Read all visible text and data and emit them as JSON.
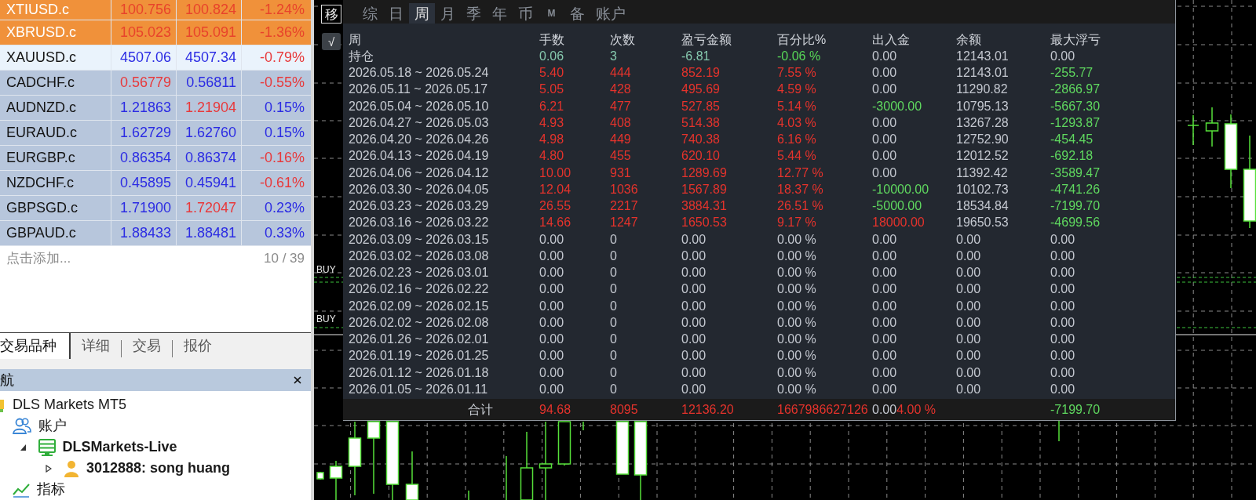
{
  "market_watch": {
    "rows": [
      {
        "color": "#f0913a",
        "symbol": {
          "text": "XTIUSD.c",
          "color": "#ffffff"
        },
        "bid": {
          "text": "100.756",
          "color": "#e8432b"
        },
        "ask": {
          "text": "100.824",
          "color": "#e8432b"
        },
        "change": {
          "text": "-1.24%",
          "color": "#e8432b"
        }
      },
      {
        "color": "#f0913a",
        "symbol": {
          "text": "XBRUSD.c",
          "color": "#ffffff"
        },
        "bid": {
          "text": "105.023",
          "color": "#e8432b"
        },
        "ask": {
          "text": "105.091",
          "color": "#e8432b"
        },
        "change": {
          "text": "-1.36%",
          "color": "#e8432b"
        }
      },
      {
        "color": "#eaf3fc",
        "symbol": {
          "text": "XAUUSD.c",
          "color": "#141414"
        },
        "bid": {
          "text": "4507.06",
          "color": "#2b2be3"
        },
        "ask": {
          "text": "4507.34",
          "color": "#2b2be3"
        },
        "change": {
          "text": "-0.79%",
          "color": "#e8383a"
        }
      },
      {
        "color": "#b7c6dc",
        "symbol": {
          "text": "CADCHF.c",
          "color": "#141414"
        },
        "bid": {
          "text": "0.56779",
          "color": "#e8383a"
        },
        "ask": {
          "text": "0.56811",
          "color": "#2b2be3"
        },
        "change": {
          "text": "-0.55%",
          "color": "#e8383a"
        }
      },
      {
        "color": "#b7c6dc",
        "symbol": {
          "text": "AUDNZD.c",
          "color": "#141414"
        },
        "bid": {
          "text": "1.21863",
          "color": "#2b2be3"
        },
        "ask": {
          "text": "1.21904",
          "color": "#e8383a"
        },
        "change": {
          "text": "0.15%",
          "color": "#2b2be3"
        }
      },
      {
        "color": "#b7c6dc",
        "symbol": {
          "text": "EURAUD.c",
          "color": "#141414"
        },
        "bid": {
          "text": "1.62729",
          "color": "#2b2be3"
        },
        "ask": {
          "text": "1.62760",
          "color": "#2b2be3"
        },
        "change": {
          "text": "0.15%",
          "color": "#2b2be3"
        }
      },
      {
        "color": "#b7c6dc",
        "symbol": {
          "text": "EURGBP.c",
          "color": "#141414"
        },
        "bid": {
          "text": "0.86354",
          "color": "#2b2be3"
        },
        "ask": {
          "text": "0.86374",
          "color": "#2b2be3"
        },
        "change": {
          "text": "-0.16%",
          "color": "#e8383a"
        }
      },
      {
        "color": "#b7c6dc",
        "symbol": {
          "text": "NZDCHF.c",
          "color": "#141414"
        },
        "bid": {
          "text": "0.45895",
          "color": "#2b2be3"
        },
        "ask": {
          "text": "0.45941",
          "color": "#2b2be3"
        },
        "change": {
          "text": "-0.61%",
          "color": "#e8383a"
        }
      },
      {
        "color": "#b7c6dc",
        "symbol": {
          "text": "GBPSGD.c",
          "color": "#141414"
        },
        "bid": {
          "text": "1.71900",
          "color": "#2b2be3"
        },
        "ask": {
          "text": "1.72047",
          "color": "#e8383a"
        },
        "change": {
          "text": "0.23%",
          "color": "#2b2be3"
        }
      },
      {
        "color": "#b7c6dc",
        "symbol": {
          "text": "GBPAUD.c",
          "color": "#141414"
        },
        "bid": {
          "text": "1.88433",
          "color": "#2b2be3"
        },
        "ask": {
          "text": "1.88481",
          "color": "#2b2be3"
        },
        "change": {
          "text": "0.33%",
          "color": "#2b2be3"
        }
      }
    ],
    "add_prompt": "点击添加...",
    "count": "10 / 39"
  },
  "panel_tabs": [
    {
      "label": "交易品种",
      "selected": true
    },
    {
      "label": "详细",
      "selected": false
    },
    {
      "label": "交易",
      "selected": false
    },
    {
      "label": "报价",
      "selected": false
    }
  ],
  "navigator": {
    "title": "航",
    "tree": [
      {
        "label": "DLS Markets MT5",
        "kind": "broker",
        "children": [
          {
            "label": "账户",
            "kind": "accounts",
            "children": [
              {
                "label": "DLSMarkets-Live",
                "kind": "server",
                "bold": true,
                "expanded": true,
                "children": [
                  {
                    "label": "3012888: song huang",
                    "kind": "account",
                    "bold": true,
                    "expanded": false
                  }
                ]
              }
            ]
          },
          {
            "label": "指标",
            "kind": "indicators"
          }
        ]
      }
    ]
  },
  "chart": {
    "tools": [
      {
        "label": "移",
        "kind": "outlined"
      },
      {
        "label": "√",
        "kind": "filled"
      }
    ],
    "order_labels": [
      "BUY",
      "BUY"
    ]
  },
  "report": {
    "tabs": [
      {
        "label": "综",
        "kind": "glyph",
        "selected": false
      },
      {
        "label": "日",
        "kind": "glyph",
        "selected": false
      },
      {
        "label": "周",
        "kind": "glyph",
        "selected": true
      },
      {
        "label": "月",
        "kind": "glyph",
        "selected": false
      },
      {
        "label": "季",
        "kind": "glyph",
        "selected": false
      },
      {
        "label": "年",
        "kind": "glyph",
        "selected": false
      },
      {
        "label": "币",
        "kind": "glyph",
        "selected": false
      },
      {
        "label": "M",
        "kind": "letter",
        "selected": false
      },
      {
        "label": "备",
        "kind": "glyph",
        "selected": false
      },
      {
        "label": "账户",
        "kind": "glyph",
        "selected": false
      }
    ],
    "columns": [
      "周",
      "手数",
      "次数",
      "盈亏金额",
      "百分比%",
      "出入金",
      "余额",
      "最大浮亏"
    ],
    "rows": [
      {
        "cells": [
          {
            "text": "持仓"
          },
          {
            "text": "0.06",
            "color": "#86c9ae"
          },
          {
            "text": "3",
            "color": "#86c9ae"
          },
          {
            "text": "-6.81",
            "color": "#86c9ae"
          },
          {
            "text": "-0.06 %",
            "color": "#58d858"
          },
          {
            "text": "0.00",
            "color": "#c4c8d0"
          },
          {
            "text": "12143.01",
            "color": "#c4c8d0"
          },
          {
            "text": "0.00",
            "color": "#c4c8d0"
          }
        ]
      },
      {
        "cells": [
          {
            "text": "2026.05.18 ~ 2026.05.24"
          },
          {
            "text": "5.40",
            "color": "#e5332c"
          },
          {
            "text": "444",
            "color": "#e5332c"
          },
          {
            "text": "852.19",
            "color": "#e5332c"
          },
          {
            "text": "7.55 %",
            "color": "#e5332c"
          },
          {
            "text": "0.00",
            "color": "#c4c8d0"
          },
          {
            "text": "12143.01",
            "color": "#c4c8d0"
          },
          {
            "text": "-255.77",
            "color": "#5fd85f"
          }
        ]
      },
      {
        "cells": [
          {
            "text": "2026.05.11 ~ 2026.05.17"
          },
          {
            "text": "5.05",
            "color": "#e5332c"
          },
          {
            "text": "428",
            "color": "#e5332c"
          },
          {
            "text": "495.69",
            "color": "#e5332c"
          },
          {
            "text": "4.59 %",
            "color": "#e5332c"
          },
          {
            "text": "0.00",
            "color": "#c4c8d0"
          },
          {
            "text": "11290.82",
            "color": "#c4c8d0"
          },
          {
            "text": "-2866.97",
            "color": "#5fd85f"
          }
        ]
      },
      {
        "cells": [
          {
            "text": "2026.05.04 ~ 2026.05.10"
          },
          {
            "text": "6.21",
            "color": "#e5332c"
          },
          {
            "text": "477",
            "color": "#e5332c"
          },
          {
            "text": "527.85",
            "color": "#e5332c"
          },
          {
            "text": "5.14 %",
            "color": "#e5332c"
          },
          {
            "text": "-3000.00",
            "color": "#5fd85f"
          },
          {
            "text": "10795.13",
            "color": "#c4c8d0"
          },
          {
            "text": "-5667.30",
            "color": "#5fd85f"
          }
        ]
      },
      {
        "cells": [
          {
            "text": "2026.04.27 ~ 2026.05.03"
          },
          {
            "text": "4.93",
            "color": "#e5332c"
          },
          {
            "text": "408",
            "color": "#e5332c"
          },
          {
            "text": "514.38",
            "color": "#e5332c"
          },
          {
            "text": "4.03 %",
            "color": "#e5332c"
          },
          {
            "text": "0.00",
            "color": "#c4c8d0"
          },
          {
            "text": "13267.28",
            "color": "#c4c8d0"
          },
          {
            "text": "-1293.87",
            "color": "#5fd85f"
          }
        ]
      },
      {
        "cells": [
          {
            "text": "2026.04.20 ~ 2026.04.26"
          },
          {
            "text": "4.98",
            "color": "#e5332c"
          },
          {
            "text": "449",
            "color": "#e5332c"
          },
          {
            "text": "740.38",
            "color": "#e5332c"
          },
          {
            "text": "6.16 %",
            "color": "#e5332c"
          },
          {
            "text": "0.00",
            "color": "#c4c8d0"
          },
          {
            "text": "12752.90",
            "color": "#c4c8d0"
          },
          {
            "text": "-454.45",
            "color": "#5fd85f"
          }
        ]
      },
      {
        "cells": [
          {
            "text": "2026.04.13 ~ 2026.04.19"
          },
          {
            "text": "4.80",
            "color": "#e5332c"
          },
          {
            "text": "455",
            "color": "#e5332c"
          },
          {
            "text": "620.10",
            "color": "#e5332c"
          },
          {
            "text": "5.44 %",
            "color": "#e5332c"
          },
          {
            "text": "0.00",
            "color": "#c4c8d0"
          },
          {
            "text": "12012.52",
            "color": "#c4c8d0"
          },
          {
            "text": "-692.18",
            "color": "#5fd85f"
          }
        ]
      },
      {
        "cells": [
          {
            "text": "2026.04.06 ~ 2026.04.12"
          },
          {
            "text": "10.00",
            "color": "#e5332c"
          },
          {
            "text": "931",
            "color": "#e5332c"
          },
          {
            "text": "1289.69",
            "color": "#e5332c"
          },
          {
            "text": "12.77 %",
            "color": "#e5332c"
          },
          {
            "text": "0.00",
            "color": "#c4c8d0"
          },
          {
            "text": "11392.42",
            "color": "#c4c8d0"
          },
          {
            "text": "-3589.47",
            "color": "#5fd85f"
          }
        ]
      },
      {
        "cells": [
          {
            "text": "2026.03.30 ~ 2026.04.05"
          },
          {
            "text": "12.04",
            "color": "#e5332c"
          },
          {
            "text": "1036",
            "color": "#e5332c"
          },
          {
            "text": "1567.89",
            "color": "#e5332c"
          },
          {
            "text": "18.37 %",
            "color": "#e5332c"
          },
          {
            "text": "-10000.00",
            "color": "#5fd85f"
          },
          {
            "text": "10102.73",
            "color": "#c4c8d0"
          },
          {
            "text": "-4741.26",
            "color": "#5fd85f"
          }
        ]
      },
      {
        "cells": [
          {
            "text": "2026.03.23 ~ 2026.03.29"
          },
          {
            "text": "26.55",
            "color": "#e5332c"
          },
          {
            "text": "2217",
            "color": "#e5332c"
          },
          {
            "text": "3884.31",
            "color": "#e5332c"
          },
          {
            "text": "26.51 %",
            "color": "#e5332c"
          },
          {
            "text": "-5000.00",
            "color": "#5fd85f"
          },
          {
            "text": "18534.84",
            "color": "#c4c8d0"
          },
          {
            "text": "-7199.70",
            "color": "#5fd85f"
          }
        ]
      },
      {
        "cells": [
          {
            "text": "2026.03.16 ~ 2026.03.22"
          },
          {
            "text": "14.66",
            "color": "#e5332c"
          },
          {
            "text": "1247",
            "color": "#e5332c"
          },
          {
            "text": "1650.53",
            "color": "#e5332c"
          },
          {
            "text": "9.17 %",
            "color": "#e5332c"
          },
          {
            "text": "18000.00",
            "color": "#e5332c"
          },
          {
            "text": "19650.53",
            "color": "#c4c8d0"
          },
          {
            "text": "-4699.56",
            "color": "#5fd85f"
          }
        ]
      },
      {
        "cells": [
          {
            "text": "2026.03.09 ~ 2026.03.15"
          },
          {
            "text": "0.00",
            "color": "#c4c8d0"
          },
          {
            "text": "0",
            "color": "#c4c8d0"
          },
          {
            "text": "0.00",
            "color": "#c4c8d0"
          },
          {
            "text": "0.00 %",
            "color": "#c4c8d0"
          },
          {
            "text": "0.00",
            "color": "#c4c8d0"
          },
          {
            "text": "0.00",
            "color": "#c4c8d0"
          },
          {
            "text": "0.00",
            "color": "#c4c8d0"
          }
        ]
      },
      {
        "cells": [
          {
            "text": "2026.03.02 ~ 2026.03.08"
          },
          {
            "text": "0.00",
            "color": "#c4c8d0"
          },
          {
            "text": "0",
            "color": "#c4c8d0"
          },
          {
            "text": "0.00",
            "color": "#c4c8d0"
          },
          {
            "text": "0.00 %",
            "color": "#c4c8d0"
          },
          {
            "text": "0.00",
            "color": "#c4c8d0"
          },
          {
            "text": "0.00",
            "color": "#c4c8d0"
          },
          {
            "text": "0.00",
            "color": "#c4c8d0"
          }
        ]
      },
      {
        "cells": [
          {
            "text": "2026.02.23 ~ 2026.03.01"
          },
          {
            "text": "0.00",
            "color": "#c4c8d0"
          },
          {
            "text": "0",
            "color": "#c4c8d0"
          },
          {
            "text": "0.00",
            "color": "#c4c8d0"
          },
          {
            "text": "0.00 %",
            "color": "#c4c8d0"
          },
          {
            "text": "0.00",
            "color": "#c4c8d0"
          },
          {
            "text": "0.00",
            "color": "#c4c8d0"
          },
          {
            "text": "0.00",
            "color": "#c4c8d0"
          }
        ]
      },
      {
        "cells": [
          {
            "text": "2026.02.16 ~ 2026.02.22"
          },
          {
            "text": "0.00",
            "color": "#c4c8d0"
          },
          {
            "text": "0",
            "color": "#c4c8d0"
          },
          {
            "text": "0.00",
            "color": "#c4c8d0"
          },
          {
            "text": "0.00 %",
            "color": "#c4c8d0"
          },
          {
            "text": "0.00",
            "color": "#c4c8d0"
          },
          {
            "text": "0.00",
            "color": "#c4c8d0"
          },
          {
            "text": "0.00",
            "color": "#c4c8d0"
          }
        ]
      },
      {
        "cells": [
          {
            "text": "2026.02.09 ~ 2026.02.15"
          },
          {
            "text": "0.00",
            "color": "#c4c8d0"
          },
          {
            "text": "0",
            "color": "#c4c8d0"
          },
          {
            "text": "0.00",
            "color": "#c4c8d0"
          },
          {
            "text": "0.00 %",
            "color": "#c4c8d0"
          },
          {
            "text": "0.00",
            "color": "#c4c8d0"
          },
          {
            "text": "0.00",
            "color": "#c4c8d0"
          },
          {
            "text": "0.00",
            "color": "#c4c8d0"
          }
        ]
      },
      {
        "cells": [
          {
            "text": "2026.02.02 ~ 2026.02.08"
          },
          {
            "text": "0.00",
            "color": "#c4c8d0"
          },
          {
            "text": "0",
            "color": "#c4c8d0"
          },
          {
            "text": "0.00",
            "color": "#c4c8d0"
          },
          {
            "text": "0.00 %",
            "color": "#c4c8d0"
          },
          {
            "text": "0.00",
            "color": "#c4c8d0"
          },
          {
            "text": "0.00",
            "color": "#c4c8d0"
          },
          {
            "text": "0.00",
            "color": "#c4c8d0"
          }
        ]
      },
      {
        "cells": [
          {
            "text": "2026.01.26 ~ 2026.02.01"
          },
          {
            "text": "0.00",
            "color": "#c4c8d0"
          },
          {
            "text": "0",
            "color": "#c4c8d0"
          },
          {
            "text": "0.00",
            "color": "#c4c8d0"
          },
          {
            "text": "0.00 %",
            "color": "#c4c8d0"
          },
          {
            "text": "0.00",
            "color": "#c4c8d0"
          },
          {
            "text": "0.00",
            "color": "#c4c8d0"
          },
          {
            "text": "0.00",
            "color": "#c4c8d0"
          }
        ]
      },
      {
        "cells": [
          {
            "text": "2026.01.19 ~ 2026.01.25"
          },
          {
            "text": "0.00",
            "color": "#c4c8d0"
          },
          {
            "text": "0",
            "color": "#c4c8d0"
          },
          {
            "text": "0.00",
            "color": "#c4c8d0"
          },
          {
            "text": "0.00 %",
            "color": "#c4c8d0"
          },
          {
            "text": "0.00",
            "color": "#c4c8d0"
          },
          {
            "text": "0.00",
            "color": "#c4c8d0"
          },
          {
            "text": "0.00",
            "color": "#c4c8d0"
          }
        ]
      },
      {
        "cells": [
          {
            "text": "2026.01.12 ~ 2026.01.18"
          },
          {
            "text": "0.00",
            "color": "#c4c8d0"
          },
          {
            "text": "0",
            "color": "#c4c8d0"
          },
          {
            "text": "0.00",
            "color": "#c4c8d0"
          },
          {
            "text": "0.00 %",
            "color": "#c4c8d0"
          },
          {
            "text": "0.00",
            "color": "#c4c8d0"
          },
          {
            "text": "0.00",
            "color": "#c4c8d0"
          },
          {
            "text": "0.00",
            "color": "#c4c8d0"
          }
        ]
      },
      {
        "cells": [
          {
            "text": "2026.01.05 ~ 2026.01.11"
          },
          {
            "text": "0.00",
            "color": "#c4c8d0"
          },
          {
            "text": "0",
            "color": "#c4c8d0"
          },
          {
            "text": "0.00",
            "color": "#c4c8d0"
          },
          {
            "text": "0.00 %",
            "color": "#c4c8d0"
          },
          {
            "text": "0.00",
            "color": "#c4c8d0"
          },
          {
            "text": "0.00",
            "color": "#c4c8d0"
          },
          {
            "text": "0.00",
            "color": "#c4c8d0"
          }
        ]
      }
    ],
    "total": {
      "cells": [
        {
          "text": "合计"
        },
        {
          "text": "94.68",
          "color": "#e5332c"
        },
        {
          "text": "8095",
          "color": "#e5332c"
        },
        {
          "text": "12136.20",
          "color": "#e5332c"
        },
        {
          "text": "1667986627126",
          "color": "#e5332c"
        },
        {
          "runs": [
            {
              "text": "0.00",
              "color": "#c4c8d0"
            },
            {
              "text": "4.00 %",
              "color": "#e5332c"
            }
          ]
        },
        {
          "text": ""
        },
        {
          "text": "-7199.70",
          "color": "#5fd85f"
        }
      ]
    }
  }
}
